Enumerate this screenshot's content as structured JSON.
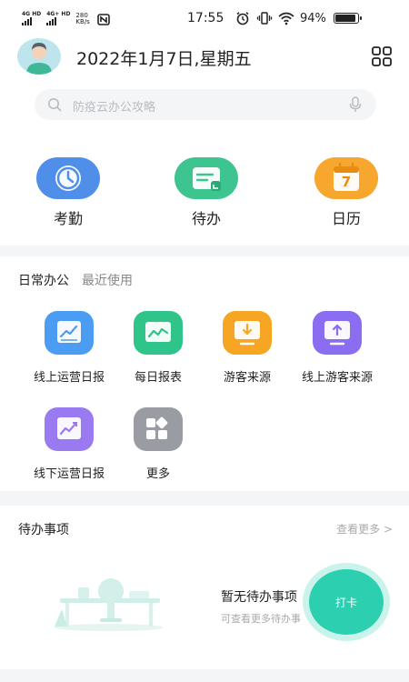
{
  "status_bar": {
    "network_1": "4G HD",
    "network_2": "4G+ HD",
    "speed_value": "280",
    "speed_unit": "KB/s",
    "nfc_icon": "nfc-icon",
    "time": "17:55",
    "alarm_icon": "alarm-icon",
    "vibrate_icon": "vibrate-icon",
    "wifi_icon": "wifi-icon",
    "battery_percent": "94%",
    "battery_level": 0.94
  },
  "header": {
    "date_title": "2022年1月7日,星期五",
    "apps_icon": "grid-apps-icon"
  },
  "search": {
    "placeholder": "防疫云办公攻略"
  },
  "quick_actions": [
    {
      "label": "考勤",
      "icon": "clock-icon",
      "color": "#4f8fea"
    },
    {
      "label": "待办",
      "icon": "todo-card-icon",
      "color": "#3ec58f"
    },
    {
      "label": "日历",
      "icon": "calendar-icon",
      "color": "#f7a62e",
      "day": "7"
    }
  ],
  "daily_office": {
    "tab_active": "日常办公",
    "tab_recent": "最近使用",
    "apps": [
      {
        "label": "线上运营日报",
        "icon": "report-chart-icon",
        "color": "#4a9df2"
      },
      {
        "label": "每日报表",
        "icon": "daily-report-icon",
        "color": "#2fc48a"
      },
      {
        "label": "游客来源",
        "icon": "download-monitor-icon",
        "color": "#f6a623"
      },
      {
        "label": "线上游客来源",
        "icon": "upload-monitor-icon",
        "color": "#8a6df0"
      },
      {
        "label": "线下运营日报",
        "icon": "trend-chart-icon",
        "color": "#9a7af0"
      },
      {
        "label": "更多",
        "icon": "more-apps-icon",
        "color": "#9a9ca3"
      }
    ]
  },
  "todo": {
    "title": "待办事项",
    "more": "查看更多 >",
    "empty_title": "暂无待办事项",
    "empty_subtitle": "可查看更多待办事",
    "punch_label": "打卡"
  }
}
